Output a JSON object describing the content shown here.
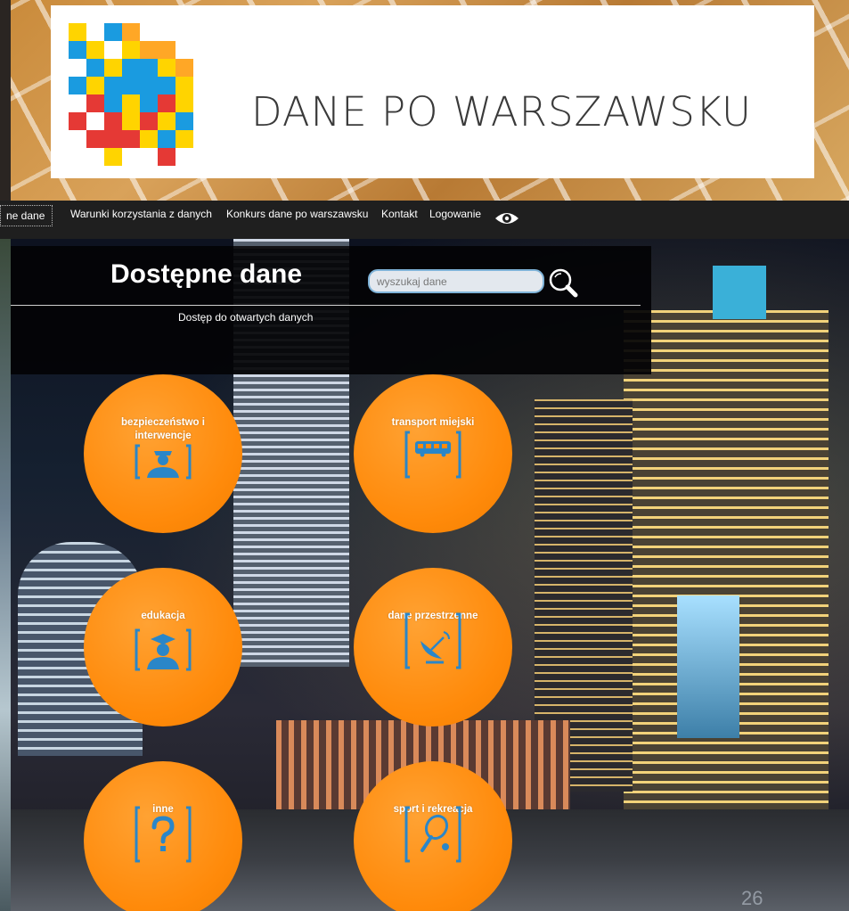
{
  "banner": {
    "title": "DANE PO WARSZAWSKU"
  },
  "nav": {
    "items": [
      "ne dane",
      "Warunki korzystania z danych",
      "Konkurs dane po warszawsku",
      "Kontakt",
      "Logowanie"
    ],
    "eye_icon": "eye-icon"
  },
  "panel": {
    "title": "Dostępne dane",
    "search_placeholder": "wyszukaj dane",
    "search_icon": "search-icon",
    "subtitle": "Dostęp do otwartych danych"
  },
  "categories": [
    {
      "label": "bezpieczeństwo i interwencje",
      "icon": "security-officer-icon"
    },
    {
      "label": "transport miejski",
      "icon": "bus-icon"
    },
    {
      "label": "edukacja",
      "icon": "graduate-icon"
    },
    {
      "label": "dane przestrzenne",
      "icon": "satellite-dish-icon"
    },
    {
      "label": "inne",
      "icon": "question-mark-icon"
    },
    {
      "label": "sport i rekreacja",
      "icon": "tennis-racket-icon"
    }
  ],
  "corner_text": "26",
  "colors": {
    "accent_orange": "#ff8a0a",
    "icon_blue": "#2a86c8",
    "nav_bg": "#1f1f1f",
    "panel_bg": "#030305"
  }
}
